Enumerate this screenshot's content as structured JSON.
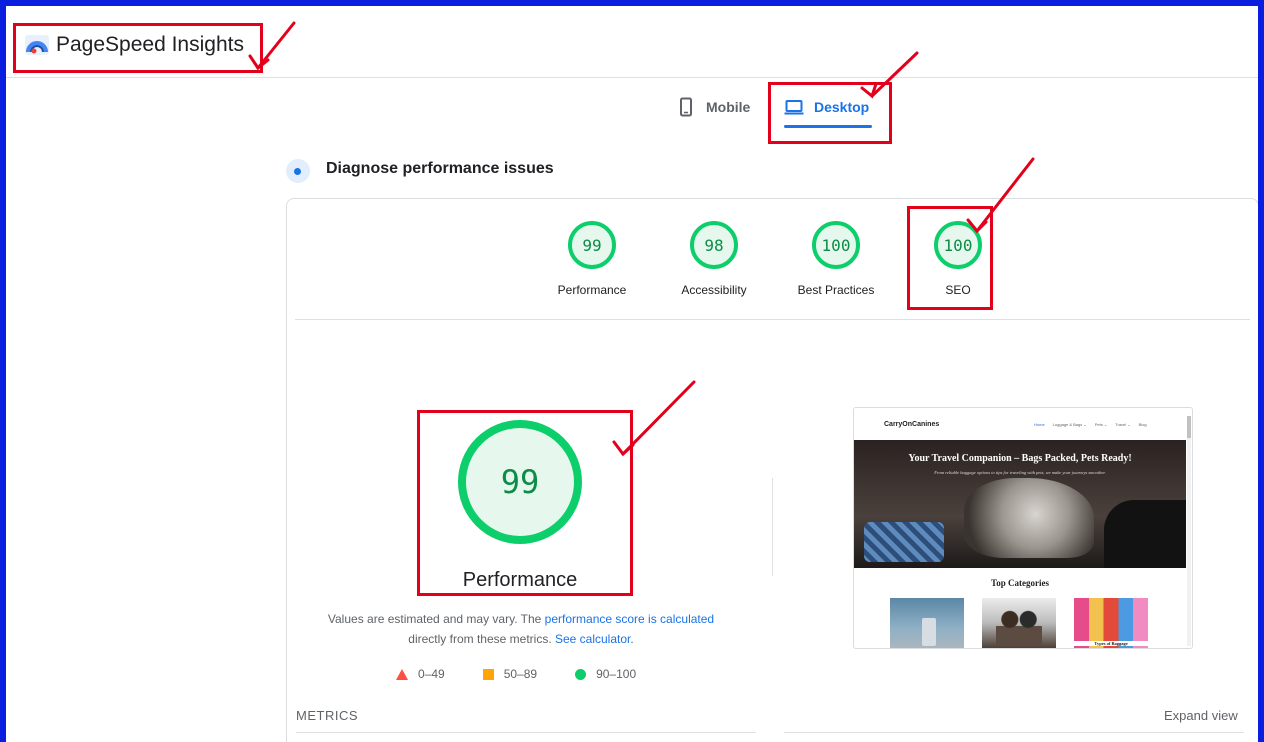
{
  "header": {
    "title": "PageSpeed Insights",
    "logo_icon": "pagespeed-gauge-icon"
  },
  "tabs": [
    {
      "label": "Mobile",
      "icon": "smartphone-icon",
      "active": false
    },
    {
      "label": "Desktop",
      "icon": "laptop-icon",
      "active": true
    }
  ],
  "diagnose": {
    "title": "Diagnose performance issues"
  },
  "categories": [
    {
      "score": "99",
      "label": "Performance"
    },
    {
      "score": "98",
      "label": "Accessibility"
    },
    {
      "score": "100",
      "label": "Best Practices"
    },
    {
      "score": "100",
      "label": "SEO"
    }
  ],
  "performance": {
    "score": "99",
    "label": "Performance",
    "note_before": "Values are estimated and may vary. The ",
    "note_link1": "performance score is calculated",
    "note_mid": " directly from these metrics. ",
    "note_link2": "See calculator",
    "note_after": "."
  },
  "legend": [
    {
      "range": "0–49",
      "shape": "triangle",
      "color": "#ff4e42"
    },
    {
      "range": "50–89",
      "shape": "square",
      "color": "#ffa400"
    },
    {
      "range": "90–100",
      "shape": "circle",
      "color": "#0cce6b"
    }
  ],
  "screenshot": {
    "brand": "CarryOnCanines",
    "menu": [
      "Home",
      "Luggage & Bags ⌄",
      "Pets ⌄",
      "Travel ⌄",
      "Blog"
    ],
    "hero_title": "Your Travel Companion – Bags Packed, Pets Ready!",
    "hero_subtitle": "From reliable baggage options to tips for traveling with pets, we make your journeys smoother.",
    "section_title": "Top Categories",
    "card_caption": "Types of Baggage"
  },
  "metrics": {
    "label": "METRICS",
    "expand": "Expand view"
  },
  "colors": {
    "pass": "#0cce6b",
    "accent": "#1a73e8",
    "annotation": "#e3001a",
    "frame": "#0a1ee0"
  }
}
